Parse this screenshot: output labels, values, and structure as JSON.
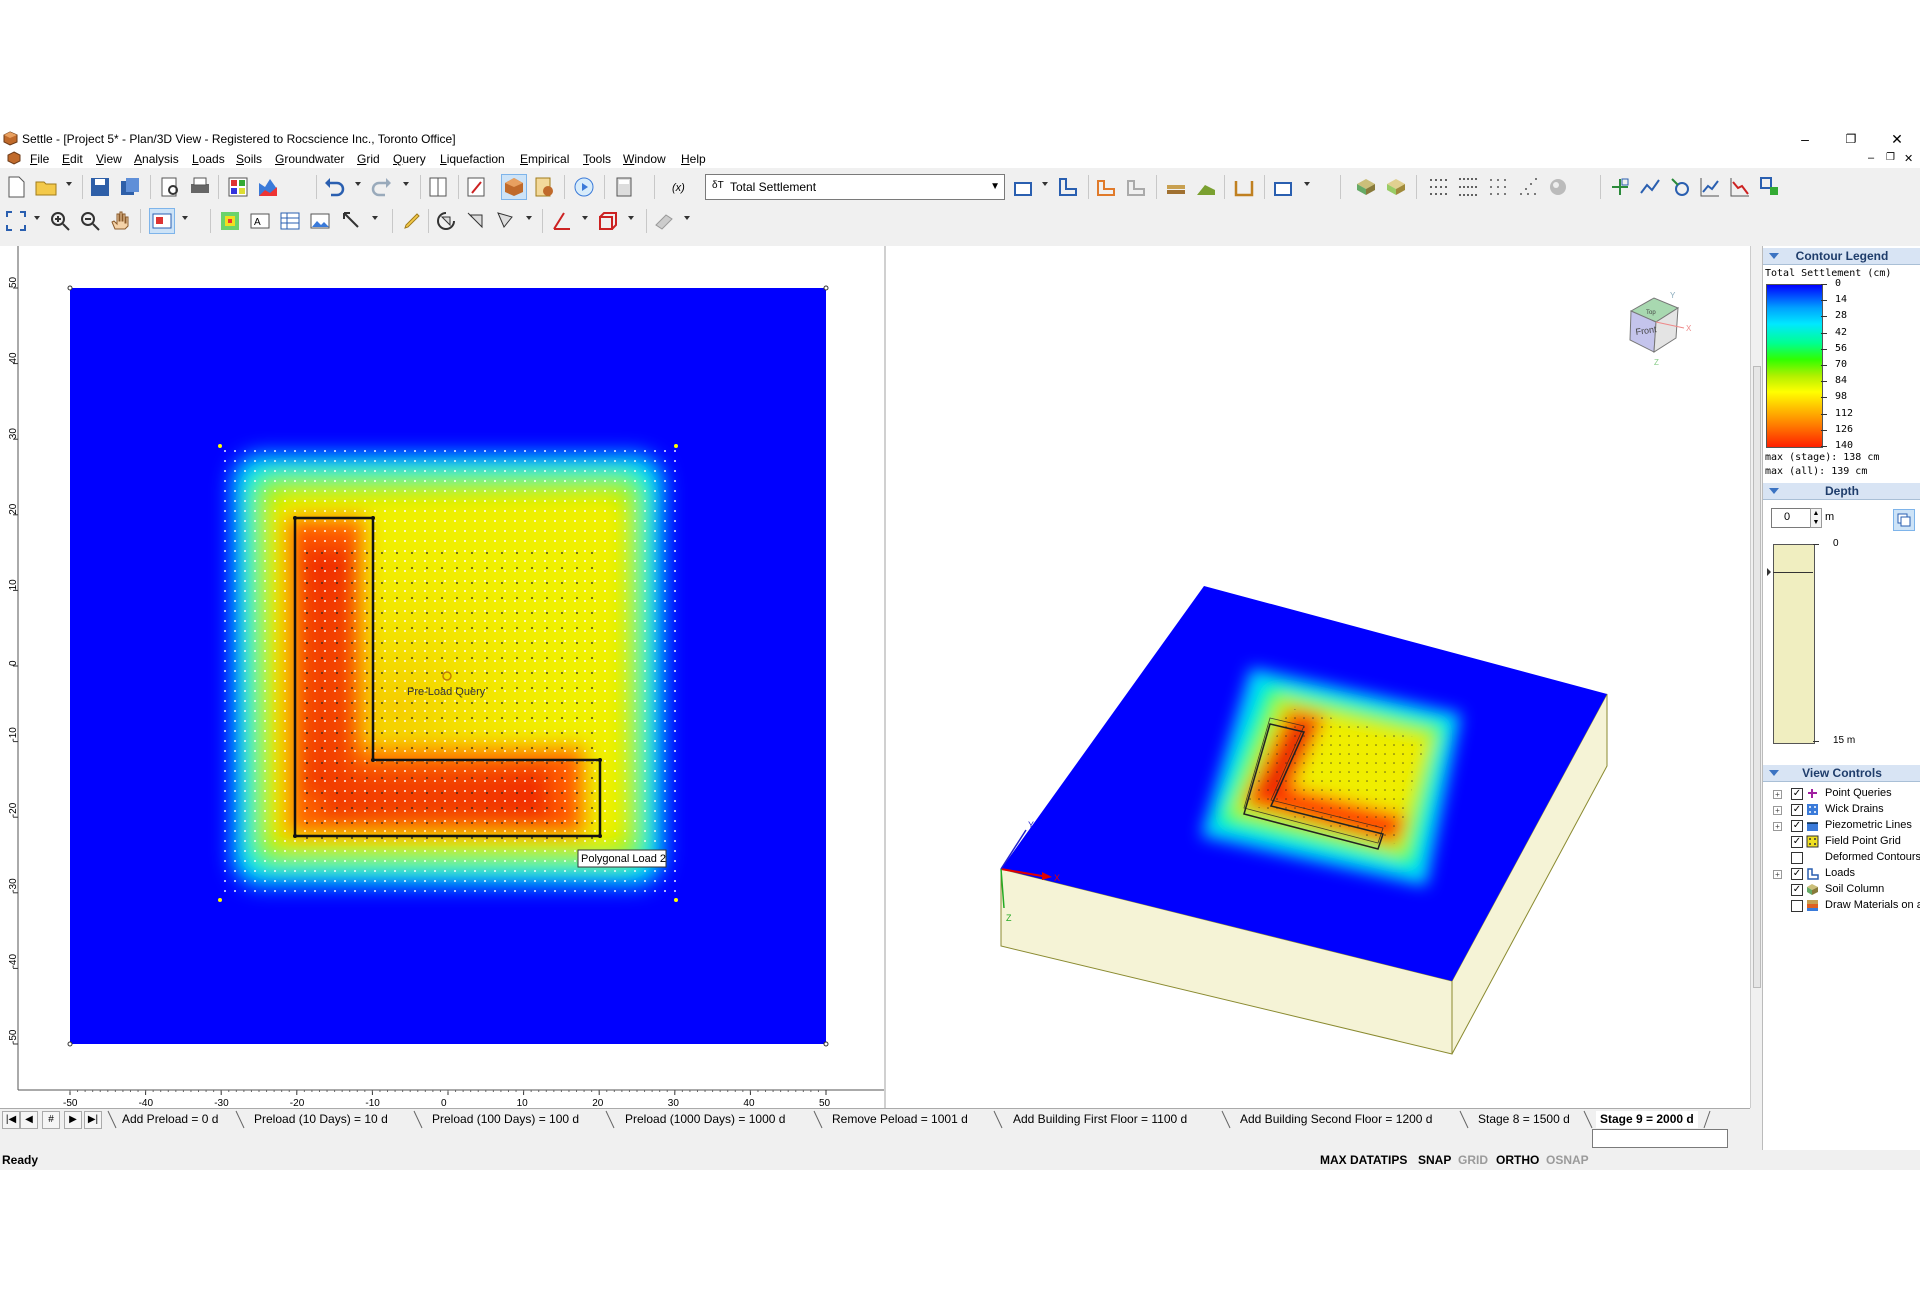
{
  "window": {
    "title": "Settle - [Project 5* - Plan/3D View - Registered to Rocscience Inc., Toronto Office]",
    "minimize_glyph": "–",
    "restore_glyph": "❐",
    "close_glyph": "✕"
  },
  "menu": {
    "items": [
      "File",
      "Edit",
      "View",
      "Analysis",
      "Loads",
      "Soils",
      "Groundwater",
      "Grid",
      "Query",
      "Liquefaction",
      "Empirical",
      "Tools",
      "Window",
      "Help"
    ]
  },
  "toolbar": {
    "result_selector": {
      "prefix": "δT",
      "value": "Total Settlement"
    },
    "function_label": "(x)"
  },
  "plan_view": {
    "x_ticks": [
      "-50",
      "-40",
      "-30",
      "-20",
      "-10",
      "0",
      "10",
      "20",
      "30",
      "40",
      "50"
    ],
    "y_ticks": [
      "50",
      "40",
      "30",
      "20",
      "10",
      "0",
      "-10",
      "-20",
      "-30",
      "-40",
      "-50"
    ],
    "query_label": "Pre-Load Query",
    "load_tooltip": "Polygonal Load 2"
  },
  "view3d": {
    "axis_x": "X",
    "axis_y": "Y",
    "axis_z": "Z",
    "cube_front": "Front",
    "cube_top": "Top"
  },
  "contour_legend": {
    "title": "Contour Legend",
    "quantity": "Total Settlement (cm)",
    "levels": [
      "0",
      "14",
      "28",
      "42",
      "56",
      "70",
      "84",
      "98",
      "112",
      "126",
      "140"
    ],
    "max_stage": "max (stage):  138 cm",
    "max_all": "max (all):   139 cm"
  },
  "depth": {
    "title": "Depth",
    "value": "0",
    "unit": "m",
    "top_label": "0",
    "bottom_label": "15 m"
  },
  "view_controls": {
    "title": "View Controls",
    "items": [
      {
        "label": "Point Queries",
        "checked": true,
        "expandable": true
      },
      {
        "label": "Wick Drains",
        "checked": true,
        "expandable": true
      },
      {
        "label": "Piezometric Lines",
        "checked": true,
        "expandable": true
      },
      {
        "label": "Field Point Grid",
        "checked": true,
        "expandable": false
      },
      {
        "label": "Deformed Contours",
        "checked": false,
        "expandable": false
      },
      {
        "label": "Loads",
        "checked": true,
        "expandable": true
      },
      {
        "label": "Soil Column",
        "checked": true,
        "expandable": false
      },
      {
        "label": "Draw Materials on all",
        "checked": false,
        "expandable": false
      }
    ]
  },
  "stages": {
    "nav": [
      "|◀",
      "◀",
      "#",
      "▶",
      "▶|"
    ],
    "tabs": [
      "Add Preload = 0 d",
      "Preload (10 Days) = 10 d",
      "Preload (100 Days) = 100 d",
      "Preload (1000 Days) = 1000 d",
      "Remove Peload = 1001 d",
      "Add Building First Floor = 1100 d",
      "Add Building Second Floor = 1200 d",
      "Stage 8 = 1500 d",
      "Stage 9 = 2000 d"
    ],
    "active_index": 8
  },
  "status": {
    "ready": "Ready",
    "indicators": [
      {
        "label": "MAX DATATIPS",
        "on": true
      },
      {
        "label": "SNAP",
        "on": true
      },
      {
        "label": "GRID",
        "on": false
      },
      {
        "label": "ORTHO",
        "on": true
      },
      {
        "label": "OSNAP",
        "on": false
      }
    ]
  },
  "colors": {
    "contour_low": "#0000ff",
    "contour_high": "#ff0000",
    "legend_header": "#d8e4f4",
    "soil_side": "#f5f3d6"
  }
}
